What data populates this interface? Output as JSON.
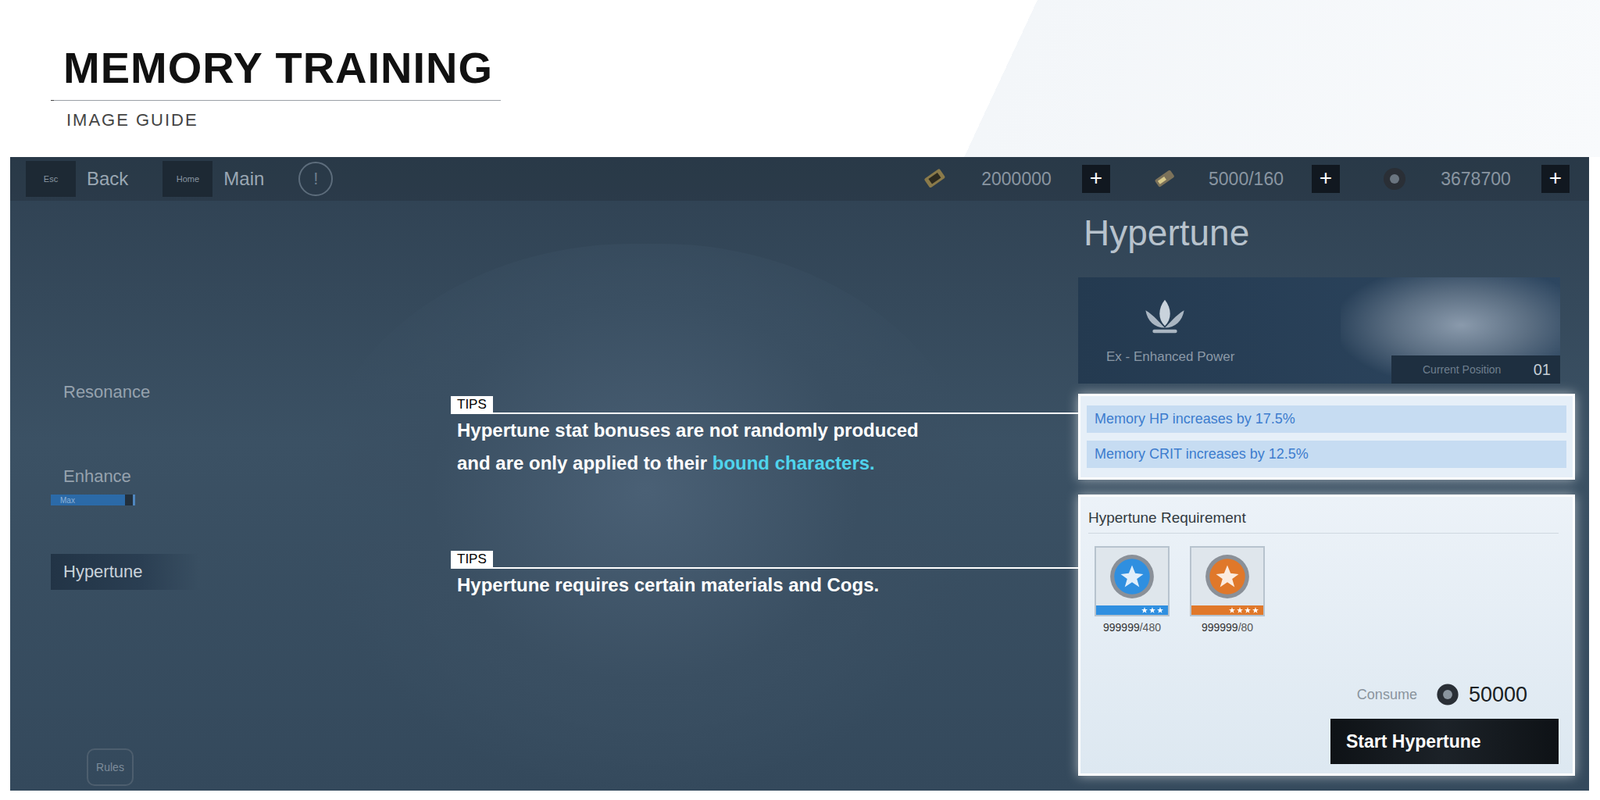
{
  "header": {
    "title": "MEMORY TRAINING",
    "subtitle": "IMAGE GUIDE"
  },
  "topbar": {
    "nav_buttons": [
      {
        "key": "Esc",
        "label": "Back"
      },
      {
        "key": "Home",
        "label": "Main"
      }
    ],
    "info": "!",
    "currencies": [
      {
        "kind": "ticket",
        "amount": "2000000",
        "add": "+"
      },
      {
        "kind": "stamina",
        "amount": "5000/160",
        "add": "+"
      },
      {
        "kind": "cog",
        "amount": "3678700",
        "add": "+"
      }
    ]
  },
  "nav": [
    {
      "label": "Resonance",
      "selected": false,
      "bar_label": "",
      "level": 0
    },
    {
      "label": "Enhance",
      "selected": false,
      "bar_label": "Max",
      "level": 0.9
    },
    {
      "label": "Hypertune",
      "selected": true,
      "bar_label": "",
      "level": 0
    }
  ],
  "rules": "Rules",
  "panel": {
    "title": "Hypertune",
    "card": {
      "name": "Ex - Enhanced Power",
      "position_label": "Current Position",
      "position": "01"
    },
    "stats": [
      "Memory HP increases by 17.5%",
      "Memory CRIT increases by 12.5%"
    ],
    "requirement": {
      "title": "Hypertune Requirement",
      "items": [
        {
          "owned": "999999",
          "need": "/480",
          "color": "#2f8fe0",
          "stars": 3
        },
        {
          "owned": "999999",
          "need": "/80",
          "color": "#e0782a",
          "stars": 4
        }
      ],
      "consume_label": "Consume",
      "consume": "50000",
      "button": "Start Hypertune"
    }
  },
  "tips": [
    {
      "label": "TIPS",
      "lines": [
        [
          {
            "text": "Hypertune stat bonuses are not randomly produced",
            "highlight": false
          }
        ],
        [
          {
            "text": "and are only applied to their ",
            "highlight": false
          },
          {
            "text": "bound characters.",
            "highlight": true
          }
        ]
      ]
    },
    {
      "label": "TIPS",
      "lines": [
        [
          {
            "text": "Hypertune requires certain materials and Cogs.",
            "highlight": false
          }
        ]
      ]
    }
  ]
}
